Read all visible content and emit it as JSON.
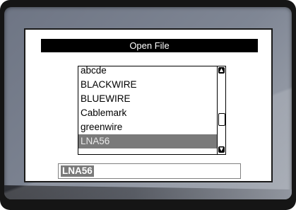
{
  "dialog": {
    "title": "Open File",
    "files": [
      {
        "label": "abcde",
        "selected": false
      },
      {
        "label": "BLACKWIRE",
        "selected": false
      },
      {
        "label": "BLUEWIRE",
        "selected": false
      },
      {
        "label": "Cablemark",
        "selected": false
      },
      {
        "label": "greenwire",
        "selected": false
      },
      {
        "label": "LNA56",
        "selected": true
      }
    ],
    "filename_value": "LNA56"
  },
  "icons": {
    "scroll_up": "scroll-up-arrow-icon",
    "scroll_down": "scroll-down-arrow-icon"
  },
  "colors": {
    "selection": "#7a7a7a",
    "title_bar": "#000000",
    "screen_bg": "#7f8694"
  }
}
